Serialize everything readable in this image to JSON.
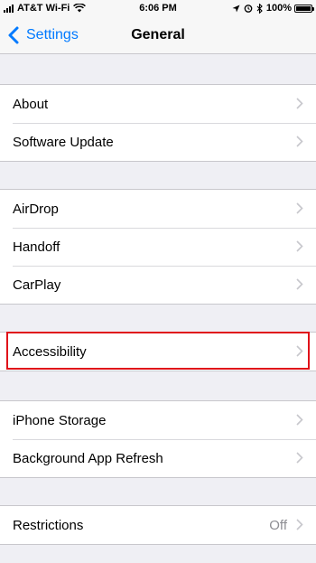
{
  "status_bar": {
    "carrier": "AT&T Wi-Fi",
    "time": "6:06 PM",
    "battery_percent": "100%",
    "battery_level": 1.0,
    "icons": [
      "signal-icon",
      "wifi-icon",
      "location-icon",
      "alarm-icon",
      "bluetooth-icon",
      "battery-icon"
    ]
  },
  "nav": {
    "back_label": "Settings",
    "title": "General"
  },
  "groups": [
    {
      "rows": [
        {
          "label": "About"
        },
        {
          "label": "Software Update"
        }
      ]
    },
    {
      "rows": [
        {
          "label": "AirDrop"
        },
        {
          "label": "Handoff"
        },
        {
          "label": "CarPlay"
        }
      ]
    },
    {
      "rows": [
        {
          "label": "Accessibility"
        }
      ]
    },
    {
      "rows": [
        {
          "label": "iPhone Storage"
        },
        {
          "label": "Background App Refresh"
        }
      ]
    },
    {
      "rows": [
        {
          "label": "Restrictions",
          "value": "Off"
        }
      ]
    }
  ],
  "colors": {
    "accent": "#007aff",
    "background": "#efeff4",
    "highlight_border": "#e0111a",
    "chevron": "#c7c7cc",
    "secondary_text": "#8e8e93"
  }
}
